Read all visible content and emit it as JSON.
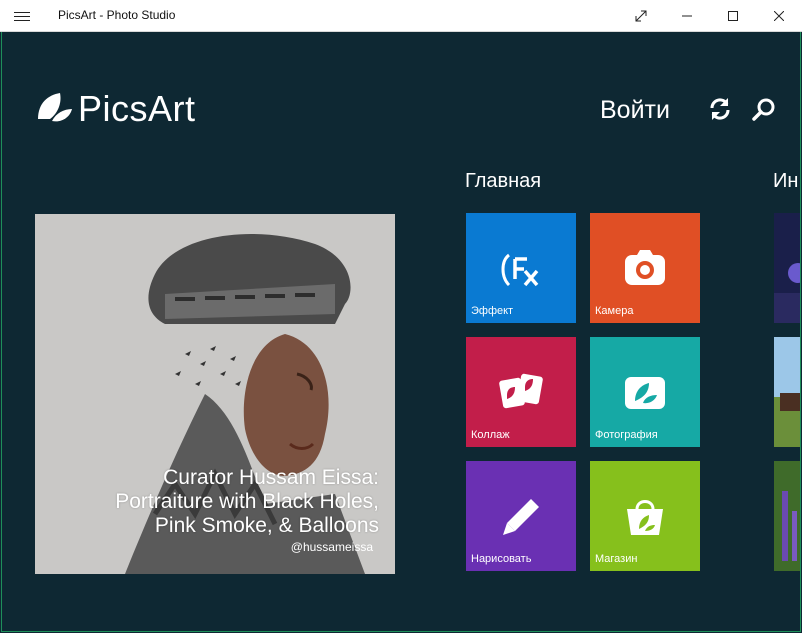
{
  "window": {
    "title": "PicsArt - Photo Studio"
  },
  "header": {
    "logo_text": "PicsArt",
    "signin_label": "Войти"
  },
  "sections": {
    "home_title": "Главная",
    "next_title": "Ин"
  },
  "featured": {
    "caption_lines": [
      "Curator Hussam Eissa:",
      "Portraiture with Black Holes,",
      "Pink Smoke, & Balloons"
    ],
    "handle": "@hussameissa"
  },
  "tiles": [
    {
      "label": "Эффект",
      "color": "#0a7ad2",
      "icon": "effects-icon"
    },
    {
      "label": "Камера",
      "color": "#e04f25",
      "icon": "camera-icon"
    },
    {
      "label": "Коллаж",
      "color": "#c21e4a",
      "icon": "collage-icon"
    },
    {
      "label": "Фотография",
      "color": "#16a9a5",
      "icon": "photo-icon"
    },
    {
      "label": "Нарисовать",
      "color": "#6a30b3",
      "icon": "draw-icon"
    },
    {
      "label": "Магазин",
      "color": "#86c01c",
      "icon": "shop-icon"
    }
  ],
  "colors": {
    "background": "#0e2833",
    "accent_border": "#1e8f5a"
  }
}
